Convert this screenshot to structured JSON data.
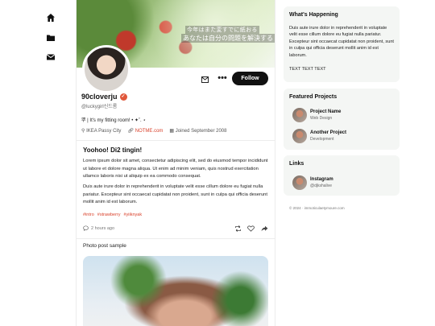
{
  "nav": {
    "icons": [
      "home-icon",
      "folder-icon",
      "mail-icon"
    ]
  },
  "banner": {
    "line1": "今年はまた変すでに紙おる",
    "line2": "あなたは自分の問題を解決する"
  },
  "profile": {
    "name": "90cloverju",
    "handle": "@luckygirl신드롬",
    "bio": "뿌 | It's my fitting room! • ✦˚. ⋆",
    "location": "IKEA Passy City",
    "link": "NOTME.com",
    "joined": "Joined September 2008",
    "follow_label": "Follow",
    "more_label": "•••"
  },
  "post": {
    "title": "Yoohoo! Di2 tingin!",
    "paragraph1": "Lorem ipsum dolor sit amet, consectetur adipiscing elit, sed do eiusmod tempor incididunt ut labore et dolore magna aliqua. Ut enim ad minim veniam, quis nostrud exercitation ullamco laboris nisi ut aliquip ex ea commodo consequat.",
    "paragraph2": "Duis aute irure dolor in reprehenderit in voluptate velit esse cillum dolore eu fugiat nulla pariatur. Excepteur sint occaecat cupidatat non proident, sunt in culpa qui officia deserunt mollit anim id est laborum.",
    "tags": [
      "#intro",
      "#strawberry",
      "#yiiknyak"
    ],
    "time": "2 hours ago"
  },
  "photo_post": {
    "label": "Photo post sample"
  },
  "sidebar": {
    "happening": {
      "title": "What's Happening",
      "text": "Duis aute irure dolor in reprehenderit in voluptate velit esse cillum dolore eu fugiat nulla pariatur. Excepteur sint occaecat cupidatat non proident, sunt in culpa qui officia deserunt mollit anim id est laborum.",
      "extra": "TEXT TEXT TEXT"
    },
    "projects": {
      "title": "Featured Projects",
      "items": [
        {
          "name": "Project Name",
          "sub": "Web Design"
        },
        {
          "name": "Another Project",
          "sub": "Development"
        }
      ]
    },
    "links": {
      "title": "Links",
      "items": [
        {
          "name": "Instagram",
          "sub": "@djkshalive"
        }
      ]
    },
    "footer": "© 2024 · immoticulaetymoure.com"
  }
}
